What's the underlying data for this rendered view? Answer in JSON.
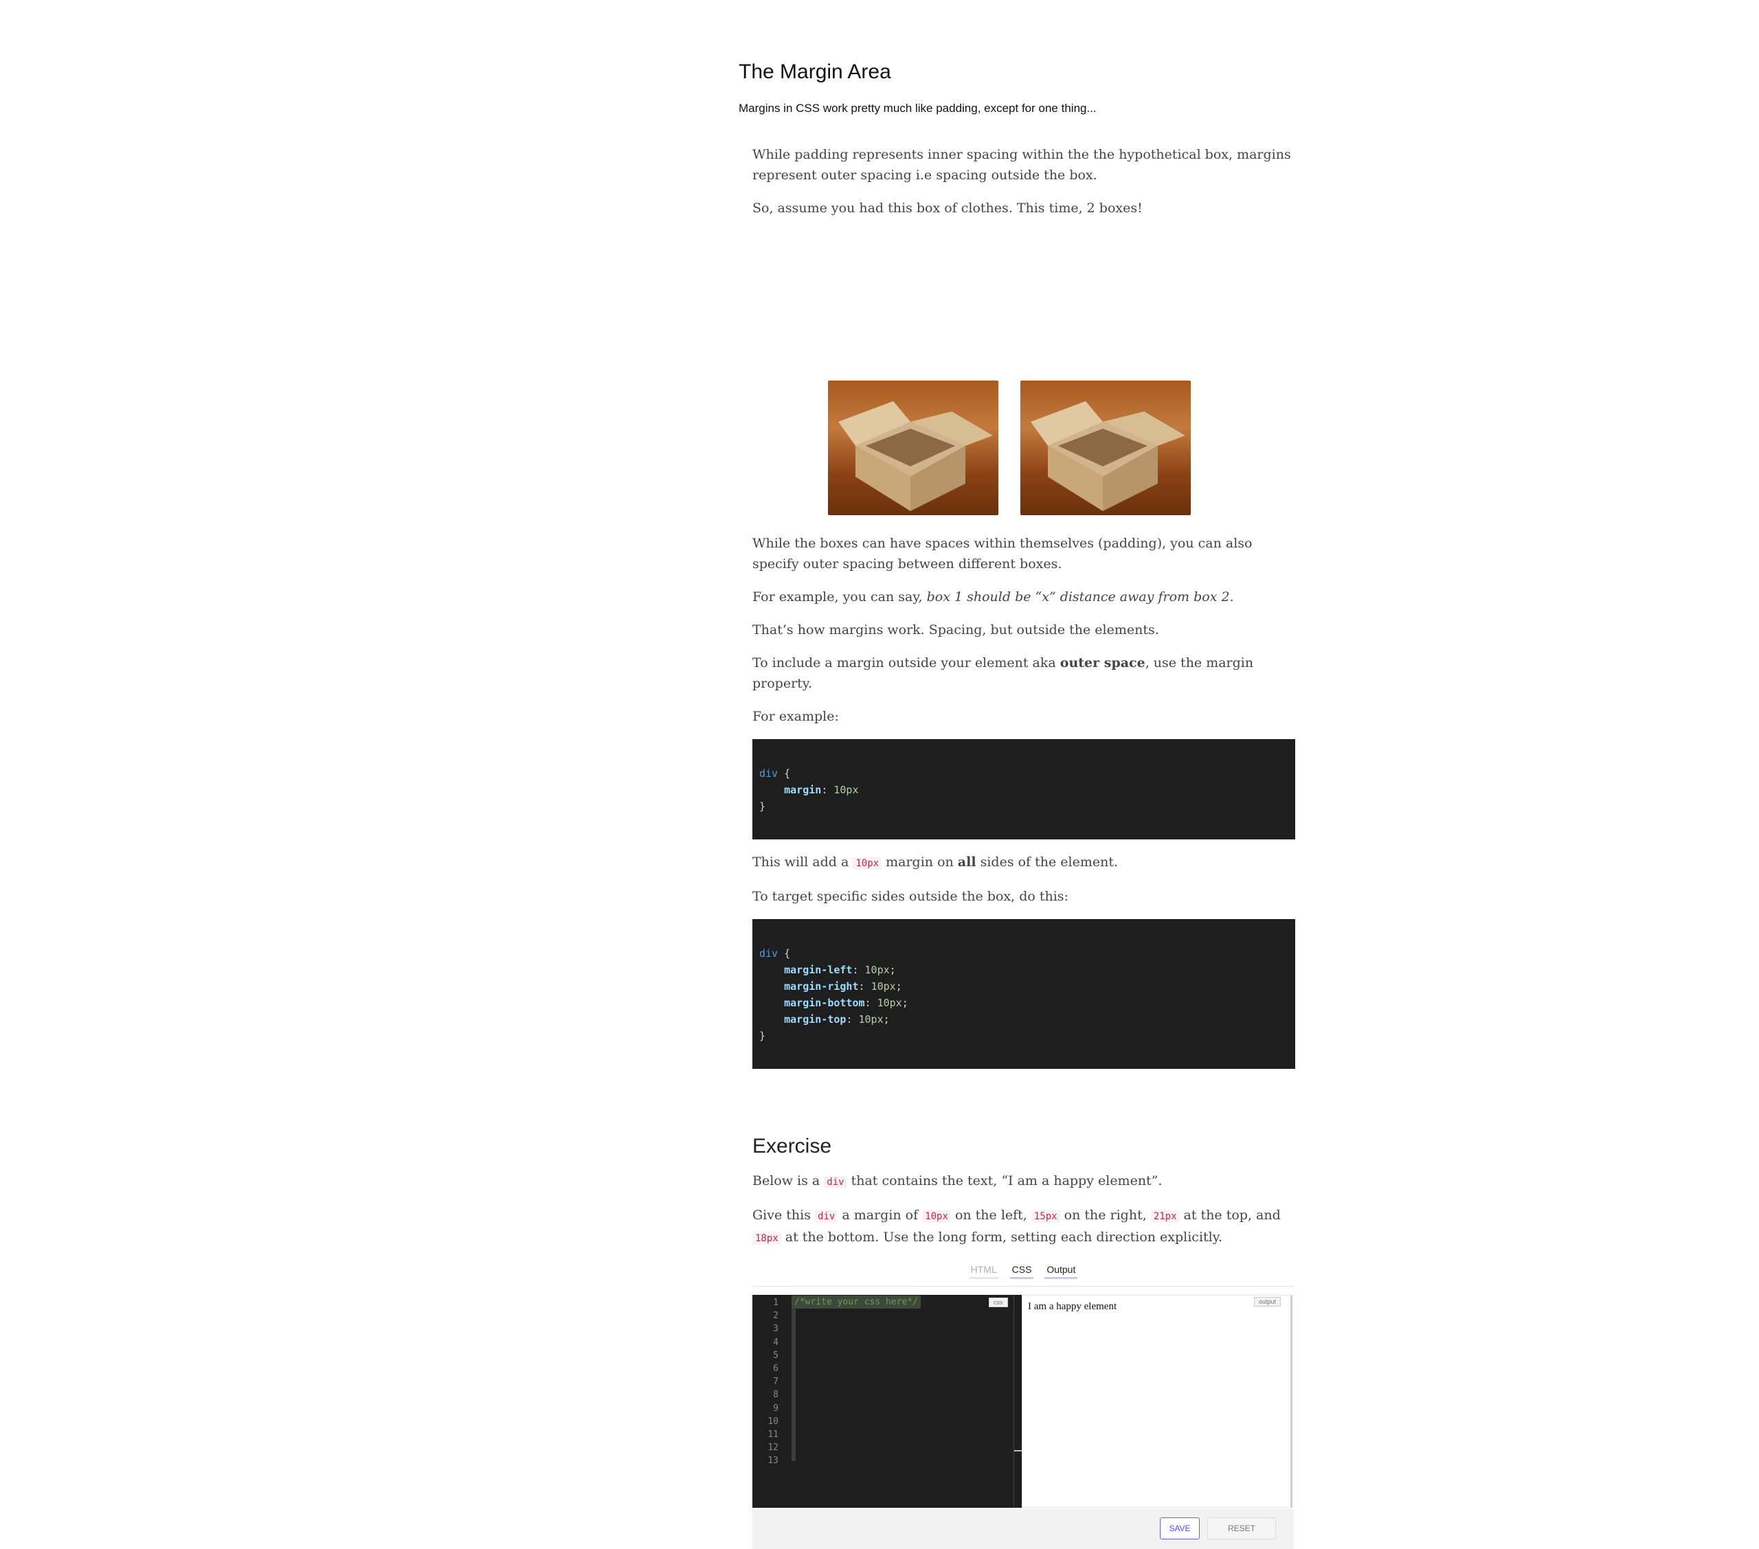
{
  "section": {
    "title": "The Margin Area",
    "subtitle": "Margins in CSS work pretty much like padding, except for one thing..."
  },
  "intro": {
    "p1": "While padding represents inner spacing within the the hypothetical box, margins represent outer spacing i.e spacing outside the box.",
    "p2": "So, assume you had this box of clothes. This time, 2 boxes!"
  },
  "images": [
    "cardboard box photo",
    "cardboard box photo"
  ],
  "body": {
    "p3": "While the boxes can have spaces within themselves (padding), you can also specify outer spacing between different boxes.",
    "p4_prefix": "For example, you can say, ",
    "p4_em": "box 1 should be “x” distance away from box 2",
    "p4_suffix": ".",
    "p5": "That’s how margins work. Spacing, but outside the elements.",
    "p6_prefix": "To include a margin outside your element aka ",
    "p6_strong": "outer space",
    "p6_suffix": ", use the margin property.",
    "p7": "For example:",
    "p8_a": "This will add a ",
    "p8_code": "10px",
    "p8_b": " margin on ",
    "p8_strong": "all",
    "p8_c": " sides of the element.",
    "p9": "To target specific sides outside the box, do this:"
  },
  "code1": {
    "selector": "div",
    "open": " {",
    "prop": "margin",
    "colon": ": ",
    "value": "10px",
    "close": "}"
  },
  "code2": {
    "selector": "div",
    "open": " {",
    "lines": [
      {
        "prop": "margin-left",
        "value": "10px"
      },
      {
        "prop": "margin-right",
        "value": "10px"
      },
      {
        "prop": "margin-bottom",
        "value": "10px"
      },
      {
        "prop": "margin-top",
        "value": "10px"
      }
    ],
    "close": "}"
  },
  "exercise": {
    "heading": "Exercise",
    "p1_a": "Below is a ",
    "p1_code": "div",
    "p1_b": " that contains the text, “I am a happy element”.",
    "p2_a": "Give this ",
    "p2_code1": "div",
    "p2_b": " a margin of ",
    "p2_code2": "10px",
    "p2_c": " on the left, ",
    "p2_code3": "15px",
    "p2_d": " on the right, ",
    "p2_code4": "21px",
    "p2_e": " at the top, and ",
    "p2_code5": "18px",
    "p2_f": " at the bottom. Use the long form, setting each direction explicitly."
  },
  "editor": {
    "tabs": [
      "HTML",
      "CSS",
      "Output"
    ],
    "line_numbers": [
      "1",
      "2",
      "3",
      "4",
      "5",
      "6",
      "7",
      "8",
      "9",
      "10",
      "11",
      "12",
      "13"
    ],
    "code_comment": "/*write your css here*/",
    "code_badge": "css",
    "output_text": "I am a happy element",
    "output_badge": "output",
    "save_label": "SAVE",
    "reset_label": "RESET"
  }
}
